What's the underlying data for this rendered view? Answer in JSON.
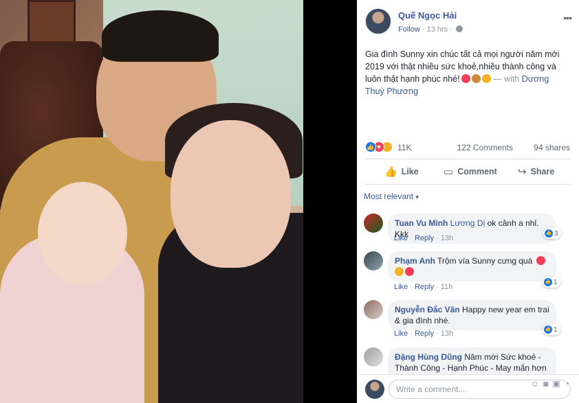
{
  "post": {
    "author": "Quế Ngọc Hải",
    "follow": "Follow",
    "time": "13 hrs",
    "text": "Gia đình Sunny xin chúc tất cả mọi người năm mới 2019 với thật nhiều sức khoẻ,nhiều thành công và luôn thật hạnh phúc nhé!",
    "with": "— with",
    "tagged": "Dương Thuỳ Phương",
    "reactions": "11K",
    "comments": "122 Comments",
    "shares": "94 shares"
  },
  "actions": {
    "like": "Like",
    "comment": "Comment",
    "share": "Share"
  },
  "filter": "Most relevant",
  "comments": [
    {
      "name": "Tuan Vu Minh",
      "mention": "Lương Dị",
      "text": "ok cảnh a nhỉ. Kkk",
      "like": "Like",
      "reply": "Reply",
      "time": "13h",
      "reactions": "3"
    },
    {
      "name": "Phạm Anh",
      "mention": "",
      "text": "Trộm vía Sunny cưng quá",
      "like": "Like",
      "reply": "Reply",
      "time": "11h",
      "reactions": "1"
    },
    {
      "name": "Nguyễn Đắc Văn",
      "mention": "",
      "text": "Happy new year em trai & gia đình nhé.",
      "like": "Like",
      "reply": "Reply",
      "time": "13h",
      "reactions": "1"
    },
    {
      "name": "Đặng Hùng Dũng",
      "mention": "",
      "text": "Năm mới Sức khoẻ - Thành Công - Hạnh Phúc - May mắn hơn",
      "like": "",
      "reply": "",
      "time": "",
      "reactions": ""
    }
  ],
  "write": {
    "placeholder": "Write a comment..."
  },
  "colors": {
    "link": "#385898",
    "like_blue": "#1877f2",
    "love_red": "#f33e58",
    "haha_yellow": "#f7b125"
  }
}
